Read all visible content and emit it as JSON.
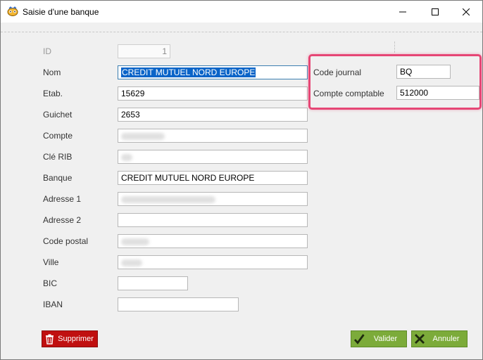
{
  "window": {
    "title": "Saisie d'une banque"
  },
  "form": {
    "id": {
      "label": "ID",
      "value": "1"
    },
    "nom": {
      "label": "Nom",
      "value": "CREDIT MUTUEL NORD EUROPE"
    },
    "etab": {
      "label": "Etab.",
      "value": "15629"
    },
    "guichet": {
      "label": "Guichet",
      "value": "2653"
    },
    "compte": {
      "label": "Compte"
    },
    "cle_rib": {
      "label": "Clé RIB"
    },
    "banque": {
      "label": "Banque",
      "value": "CREDIT MUTUEL NORD EUROPE"
    },
    "adresse1": {
      "label": "Adresse 1"
    },
    "adresse2": {
      "label": "Adresse 2",
      "value": ""
    },
    "code_postal": {
      "label": "Code postal"
    },
    "ville": {
      "label": "Ville"
    },
    "bic": {
      "label": "BIC",
      "value": ""
    },
    "iban": {
      "label": "IBAN",
      "value": ""
    },
    "code_journal": {
      "label": "Code journal",
      "value": "BQ"
    },
    "compte_comptable": {
      "label": "Compte comptable",
      "value": "512000"
    }
  },
  "buttons": {
    "delete_label": "Supprimer",
    "ok_label": "Valider",
    "cancel_label": "Annuler"
  },
  "colors": {
    "highlight": "#e64675",
    "delete_button": "#c01010",
    "action_button": "#7cab3a",
    "selection": "#0a64c8"
  },
  "icons": {
    "app": "app-icon",
    "minimize": "minimize-icon",
    "maximize": "maximize-icon",
    "close": "close-icon",
    "delete": "trash-icon",
    "ok": "checkmark-icon",
    "cancel": "x-mark-icon"
  }
}
